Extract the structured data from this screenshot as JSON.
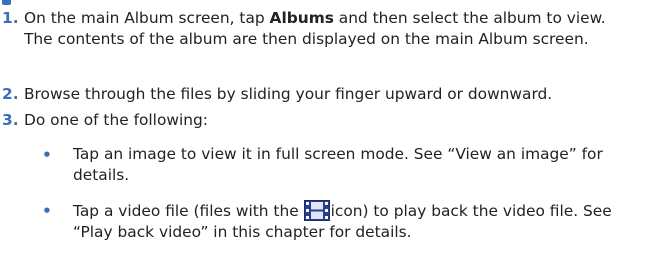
{
  "colors": {
    "accent": "#3b6fb6",
    "text": "#222222",
    "icon_fill": "#2a3f8c"
  },
  "steps": [
    {
      "number": "1.",
      "text_before": "On the main Album screen, tap ",
      "bold": "Albums",
      "text_after": " and then select the album to view. The contents of the album are then displayed on the main Album screen."
    },
    {
      "number": "2.",
      "text": "Browse through the files by sliding your finger upward or downward."
    },
    {
      "number": "3.",
      "text": "Do one of the following:"
    }
  ],
  "bullets": [
    {
      "marker": "•",
      "text": "Tap an image to view it in full screen mode. See “View an image” for details."
    },
    {
      "marker": "•",
      "text_before": "Tap a video file (files with the ",
      "icon": "video-file-film-icon",
      "text_after": "icon) to play back the video file. See “Play back video” in this chapter for details."
    }
  ]
}
